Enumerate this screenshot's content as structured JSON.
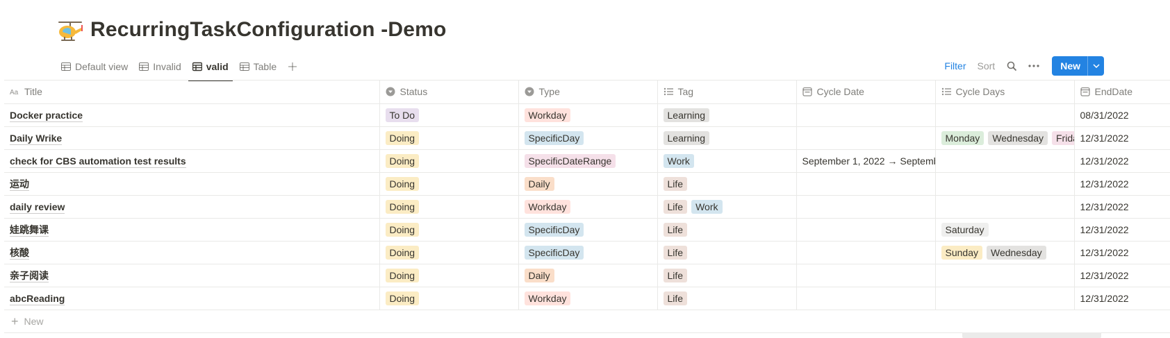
{
  "page": {
    "icon": "helicopter-icon",
    "title": "RecurringTaskConfiguration -Demo"
  },
  "tabs": [
    {
      "label": "Default view",
      "icon": "table-icon",
      "active": false
    },
    {
      "label": "Invalid",
      "icon": "table-icon",
      "active": false
    },
    {
      "label": "valid",
      "icon": "table-icon",
      "active": true
    },
    {
      "label": "Table",
      "icon": "table-icon",
      "active": false
    }
  ],
  "toolbar": {
    "filter": "Filter",
    "sort": "Sort",
    "search_icon": "search-icon",
    "more_icon": "more-horizontal-icon",
    "new_label": "New",
    "new_caret_icon": "chevron-down-icon"
  },
  "columns": [
    {
      "label": "Title",
      "icon": "text-icon"
    },
    {
      "label": "Status",
      "icon": "select-icon"
    },
    {
      "label": "Type",
      "icon": "select-icon"
    },
    {
      "label": "Tag",
      "icon": "multiselect-icon"
    },
    {
      "label": "Cycle Date",
      "icon": "calendar-icon"
    },
    {
      "label": "Cycle Days",
      "icon": "multiselect-icon"
    },
    {
      "label": "EndDate",
      "icon": "calendar-icon"
    }
  ],
  "rows": [
    {
      "title": "Docker practice",
      "status": "To Do",
      "type": "Workday",
      "tags": [
        "Learning"
      ],
      "cycle_date": "",
      "cycle_days": [],
      "end_date": "08/31/2022"
    },
    {
      "title": "Daily Wrike",
      "status": "Doing",
      "type": "SpecificDay",
      "tags": [
        "Learning"
      ],
      "cycle_date": "",
      "cycle_days": [
        "Monday",
        "Wednesday",
        "Frida"
      ],
      "end_date": "12/31/2022"
    },
    {
      "title": "check for CBS automation test results",
      "status": "Doing",
      "type": "SpecificDateRange",
      "tags": [
        "Work"
      ],
      "cycle_date": "September 1, 2022 → Septemb",
      "cycle_days": [],
      "end_date": "12/31/2022"
    },
    {
      "title": "运动",
      "status": "Doing",
      "type": "Daily",
      "tags": [
        "Life"
      ],
      "cycle_date": "",
      "cycle_days": [],
      "end_date": "12/31/2022"
    },
    {
      "title": "daily review",
      "status": "Doing",
      "type": "Workday",
      "tags": [
        "Life",
        "Work"
      ],
      "cycle_date": "",
      "cycle_days": [],
      "end_date": "12/31/2022"
    },
    {
      "title": "娃跳舞课",
      "status": "Doing",
      "type": "SpecificDay",
      "tags": [
        "Life"
      ],
      "cycle_date": "",
      "cycle_days": [
        "Saturday"
      ],
      "end_date": "12/31/2022"
    },
    {
      "title": "核酸",
      "status": "Doing",
      "type": "SpecificDay",
      "tags": [
        "Life"
      ],
      "cycle_date": "",
      "cycle_days": [
        "Sunday",
        "Wednesday"
      ],
      "end_date": "12/31/2022"
    },
    {
      "title": "亲子阅读",
      "status": "Doing",
      "type": "Daily",
      "tags": [
        "Life"
      ],
      "cycle_date": "",
      "cycle_days": [],
      "end_date": "12/31/2022"
    },
    {
      "title": "abcReading",
      "status": "Doing",
      "type": "Workday",
      "tags": [
        "Life"
      ],
      "cycle_date": "",
      "cycle_days": [],
      "end_date": "12/31/2022"
    }
  ],
  "new_row_label": "New",
  "colors": {
    "accent": "#2383e2",
    "pill_colors": {
      "To Do": "#e8deee",
      "Doing": "#fbecc4",
      "Workday": "#ffe2dd",
      "SpecificDay": "#d3e5ef",
      "SpecificDateRange": "#f5e0e9",
      "Daily": "#fadec9",
      "Learning": "#e3e2e0",
      "Work": "#d3e5ef",
      "Life": "#eee0da",
      "Monday": "#dbeddb",
      "Wednesday": "#e3e2e0",
      "Frida": "#f5e0e9",
      "Saturday": "#efefee",
      "Sunday": "#fbecc4"
    }
  }
}
